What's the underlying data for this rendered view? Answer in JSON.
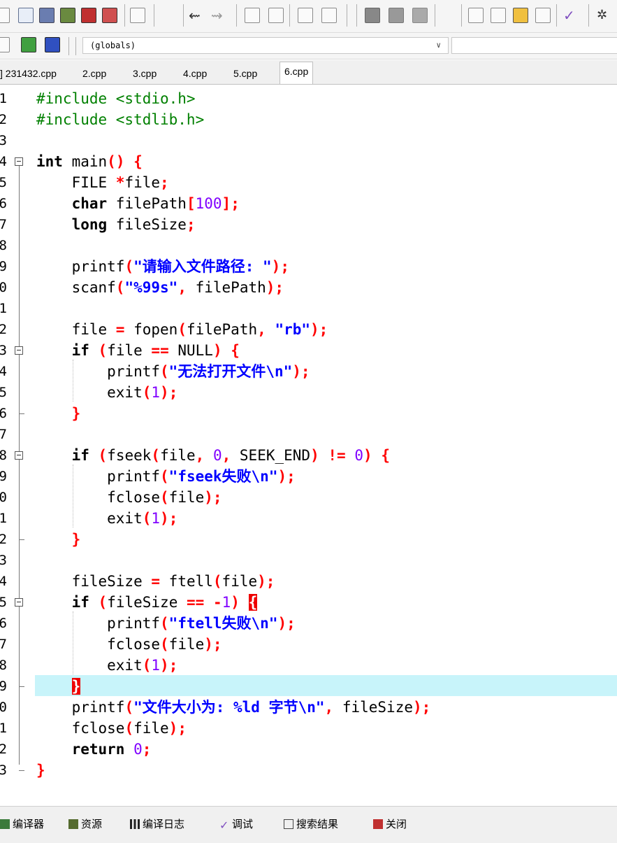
{
  "toolbar": {
    "icons": [
      "new-file-icon",
      "open-file-icon",
      "save-icon",
      "save-all-icon",
      "close-icon",
      "close-all-icon",
      "print-icon",
      "undo-icon",
      "redo-icon",
      "search-icon",
      "replace-icon",
      "indent-icon",
      "unindent-icon",
      "bookmark-icon",
      "bookmark-prev-icon",
      "bookmark-next-icon",
      "grid-icon",
      "window-icon",
      "project-icon",
      "layout-icon",
      "check-icon"
    ],
    "scope_value": "(globals)"
  },
  "tabs": [
    {
      "label": "] 231432.cpp"
    },
    {
      "label": "2.cpp"
    },
    {
      "label": "3.cpp"
    },
    {
      "label": "4.cpp"
    },
    {
      "label": "5.cpp"
    },
    {
      "label": "6.cpp",
      "active": true
    }
  ],
  "editor": {
    "line_numbers": [
      "1",
      "2",
      "3",
      "4",
      "5",
      "6",
      "7",
      "8",
      "9",
      "0",
      "1",
      "2",
      "3",
      "4",
      "5",
      "6",
      "7",
      "8",
      "9",
      "0",
      "1",
      "2",
      "3",
      "4",
      "5",
      "6",
      "7",
      "8",
      "9",
      "0",
      "1",
      "2",
      "3"
    ],
    "lines": [
      "#include <stdio.h>",
      "#include <stdlib.h>",
      "",
      "int main() {",
      "    FILE *file;",
      "    char filePath[100];",
      "    long fileSize;",
      "",
      "    printf(\"请输入文件路径: \");",
      "    scanf(\"%99s\", filePath);",
      "",
      "    file = fopen(filePath, \"rb\");",
      "    if (file == NULL) {",
      "        printf(\"无法打开文件\\n\");",
      "        exit(1);",
      "    }",
      "",
      "    if (fseek(file, 0, SEEK_END) != 0) {",
      "        printf(\"fseek失败\\n\");",
      "        fclose(file);",
      "        exit(1);",
      "    }",
      "",
      "    fileSize = ftell(file);",
      "    if (fileSize == -1) {",
      "        printf(\"ftell失败\\n\");",
      "        fclose(file);",
      "        exit(1);",
      "    }",
      "    printf(\"文件大小为: %ld 字节\\n\", fileSize);",
      "    fclose(file);",
      "    return 0;",
      "}"
    ],
    "current_line": 29
  },
  "bottom_tabs": [
    {
      "label": "编译器",
      "icon": "compiler-icon"
    },
    {
      "label": "资源",
      "icon": "resources-icon"
    },
    {
      "label": "编译日志",
      "icon": "compile-log-icon"
    },
    {
      "label": "调试",
      "icon": "debug-icon"
    },
    {
      "label": "搜索结果",
      "icon": "search-results-icon"
    },
    {
      "label": "关闭",
      "icon": "close-panel-icon"
    }
  ]
}
